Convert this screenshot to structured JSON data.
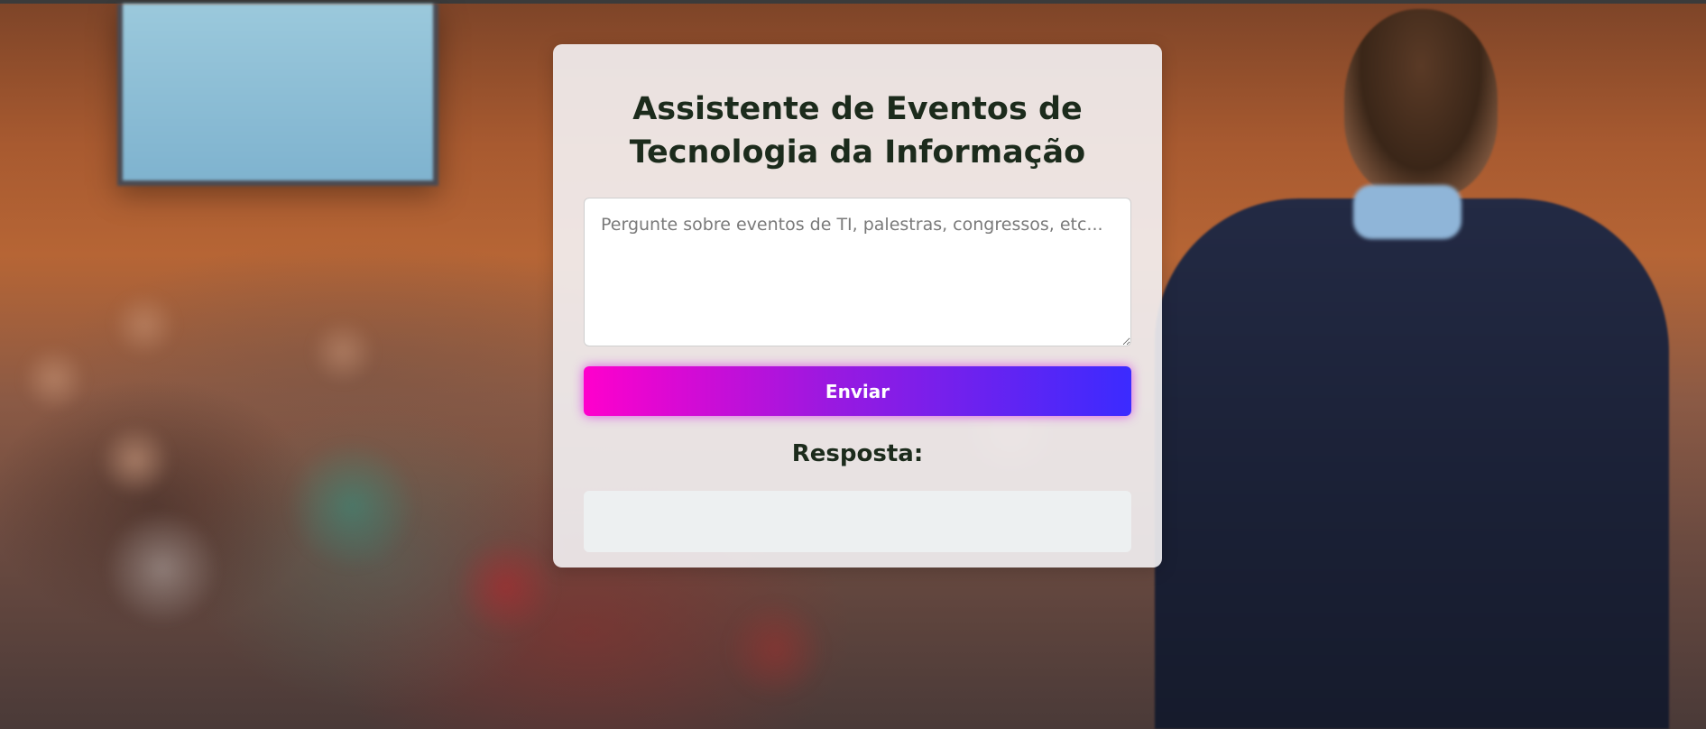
{
  "app": {
    "title": "Assistente de Eventos de Tecnologia da Informação"
  },
  "form": {
    "question_value": "",
    "question_placeholder": "Pergunte sobre eventos de TI, palestras, congressos, etc...",
    "submit_label": "Enviar"
  },
  "response": {
    "title": "Resposta:",
    "content": ""
  },
  "colors": {
    "title_text": "#1c2b1c",
    "button_gradient_start": "#ff00cc",
    "button_gradient_end": "#3b2bff",
    "response_box_bg": "#edf0f1"
  },
  "background": {
    "description_icon": "conference-hall-photo"
  }
}
